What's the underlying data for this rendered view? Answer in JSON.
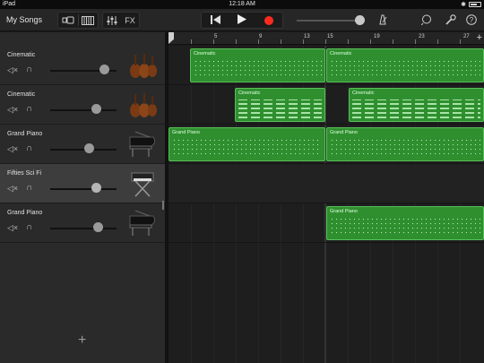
{
  "status_bar": {
    "device": "iPad",
    "time": "12:18 AM"
  },
  "toolbar": {
    "my_songs_label": "My Songs",
    "fx_label": "FX"
  },
  "tracks": [
    {
      "name": "Cinematic",
      "instrument_icon": "strings-icon",
      "volume": 0.8
    },
    {
      "name": "Cinematic",
      "instrument_icon": "strings-icon",
      "volume": 0.68
    },
    {
      "name": "Grand Piano",
      "instrument_icon": "grand-piano-icon",
      "volume": 0.6
    },
    {
      "name": "Fifties Sci Fi",
      "instrument_icon": "keyboard-icon",
      "volume": 0.68,
      "selected": true
    },
    {
      "name": "Grand Piano",
      "instrument_icon": "grand-piano-icon",
      "volume": 0.7
    }
  ],
  "ruler": {
    "bars": [
      "5",
      "9",
      "13",
      "15",
      "19",
      "23",
      "27"
    ]
  },
  "regions": [
    {
      "track": 0,
      "name": "Cinematic"
    },
    {
      "track": 0,
      "name": "Cinematic"
    },
    {
      "track": 1,
      "name": "Cinematic"
    },
    {
      "track": 1,
      "name": "Cinematic"
    },
    {
      "track": 2,
      "name": "Grand Piano"
    },
    {
      "track": 2,
      "name": "Grand Piano"
    },
    {
      "track": 4,
      "name": "Grand Piano"
    }
  ],
  "colors": {
    "region_fill": "#2f8f2f",
    "region_border": "#58c058",
    "record": "#ff2b1e"
  }
}
